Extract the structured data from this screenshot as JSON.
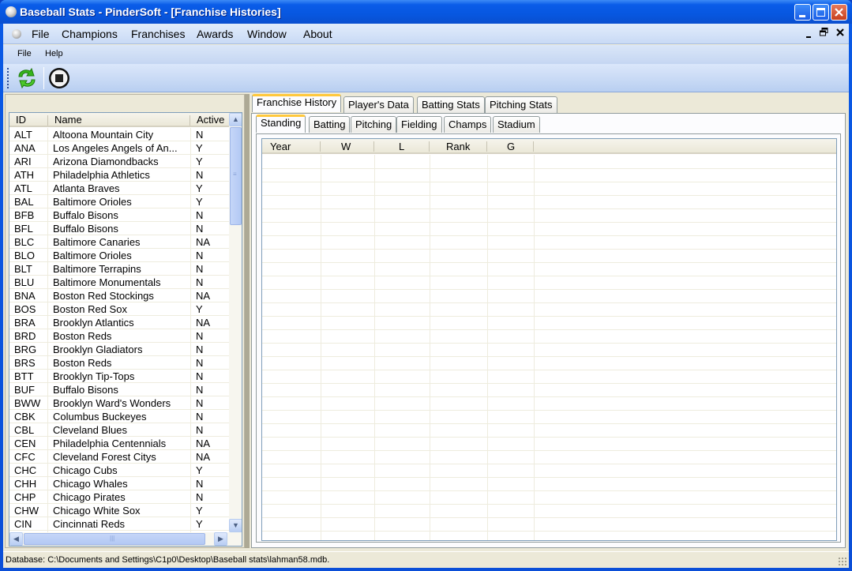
{
  "window": {
    "title": "Baseball Stats - PinderSoft - [Franchise Histories]"
  },
  "main_menu": [
    "File",
    "Champions",
    "Franchises",
    "Awards",
    "Window",
    "About"
  ],
  "mdi_controls": {
    "minimize": "‒",
    "restore": "🗗",
    "close": "✕"
  },
  "sub_menu": [
    "File",
    "Help"
  ],
  "toolbar": {
    "buttons": [
      {
        "name": "refresh",
        "icon": "refresh-icon"
      },
      {
        "name": "stop",
        "icon": "stop-icon"
      }
    ]
  },
  "franchise_list": {
    "columns": [
      "ID",
      "Name",
      "Active"
    ],
    "rows": [
      [
        "ALT",
        "Altoona Mountain City",
        "N"
      ],
      [
        "ANA",
        "Los Angeles Angels of An...",
        "Y"
      ],
      [
        "ARI",
        "Arizona Diamondbacks",
        "Y"
      ],
      [
        "ATH",
        "Philadelphia Athletics",
        "N"
      ],
      [
        "ATL",
        "Atlanta Braves",
        "Y"
      ],
      [
        "BAL",
        "Baltimore Orioles",
        "Y"
      ],
      [
        "BFB",
        "Buffalo Bisons",
        "N"
      ],
      [
        "BFL",
        "Buffalo Bisons",
        "N"
      ],
      [
        "BLC",
        "Baltimore Canaries",
        "NA"
      ],
      [
        "BLO",
        "Baltimore Orioles",
        "N"
      ],
      [
        "BLT",
        "Baltimore Terrapins",
        "N"
      ],
      [
        "BLU",
        "Baltimore Monumentals",
        "N"
      ],
      [
        "BNA",
        "Boston Red Stockings",
        "NA"
      ],
      [
        "BOS",
        "Boston Red Sox",
        "Y"
      ],
      [
        "BRA",
        "Brooklyn Atlantics",
        "NA"
      ],
      [
        "BRD",
        "Boston Reds",
        "N"
      ],
      [
        "BRG",
        "Brooklyn Gladiators",
        "N"
      ],
      [
        "BRS",
        "Boston Reds",
        "N"
      ],
      [
        "BTT",
        "Brooklyn Tip-Tops",
        "N"
      ],
      [
        "BUF",
        "Buffalo Bisons",
        "N"
      ],
      [
        "BWW",
        "Brooklyn Ward's Wonders",
        "N"
      ],
      [
        "CBK",
        "Columbus Buckeyes",
        "N"
      ],
      [
        "CBL",
        "Cleveland Blues",
        "N"
      ],
      [
        "CEN",
        "Philadelphia Centennials",
        "NA"
      ],
      [
        "CFC",
        "Cleveland Forest Citys",
        "NA"
      ],
      [
        "CHC",
        "Chicago Cubs",
        "Y"
      ],
      [
        "CHH",
        "Chicago Whales",
        "N"
      ],
      [
        "CHP",
        "Chicago Pirates",
        "N"
      ],
      [
        "CHW",
        "Chicago White Sox",
        "Y"
      ],
      [
        "CIN",
        "Cincinnati Reds",
        "Y"
      ]
    ]
  },
  "main_tabs": [
    "Franchise History",
    "Player's Data",
    "Batting Stats",
    "Pitching Stats"
  ],
  "main_tab_active": "Franchise History",
  "sub_tabs": [
    "Standing",
    "Batting",
    "Pitching",
    "Fielding",
    "Champs",
    "Stadium"
  ],
  "sub_tab_active": "Standing",
  "standing_grid": {
    "columns": [
      "Year",
      "W",
      "L",
      "Rank",
      "G"
    ],
    "rows": []
  },
  "status": {
    "text": "Database: C:\\Documents and Settings\\C1p0\\Desktop\\Baseball stats\\lahman58.mdb."
  }
}
